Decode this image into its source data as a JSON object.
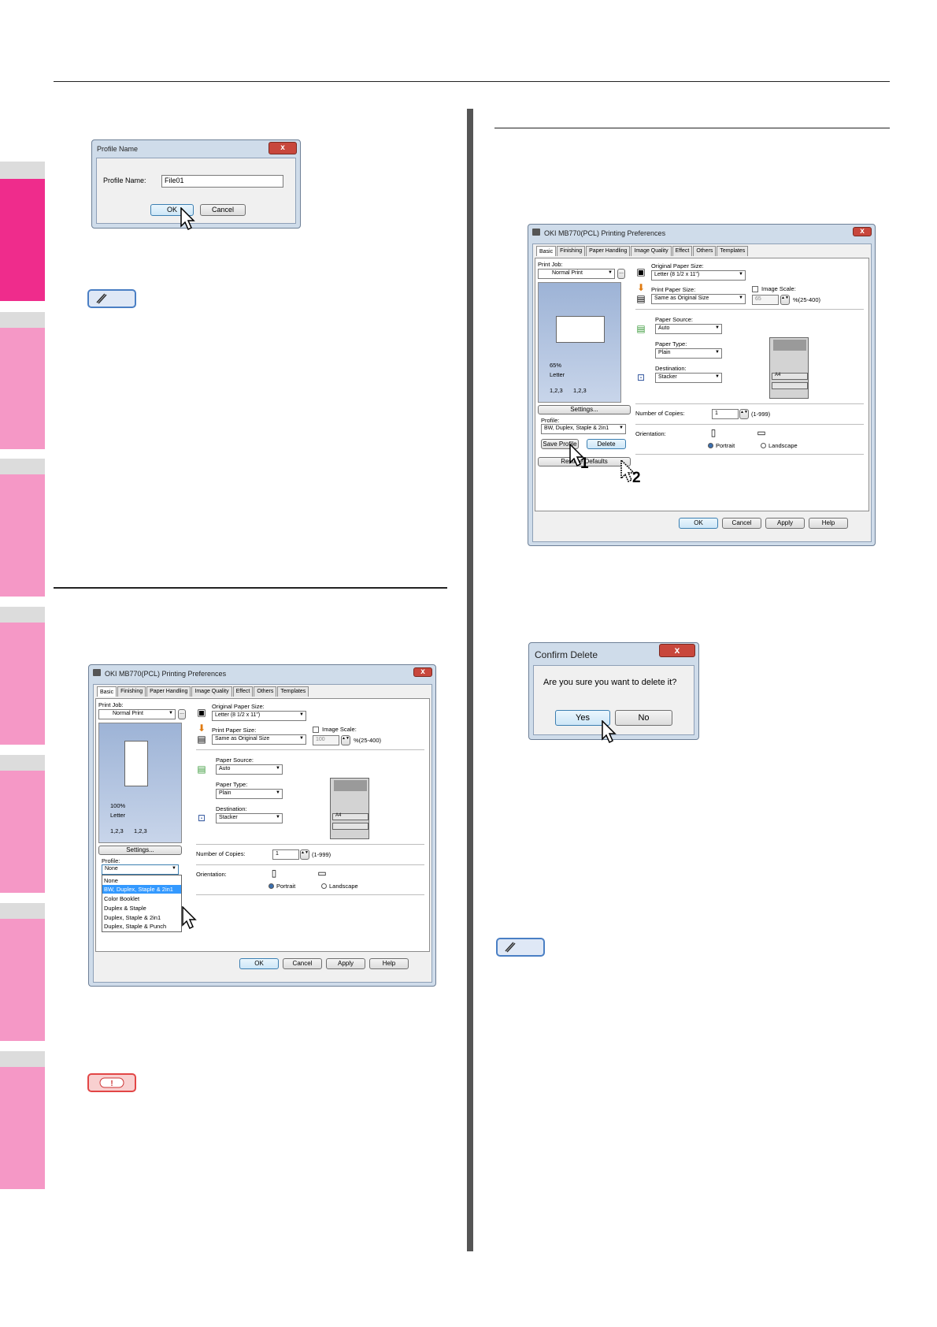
{
  "profile_name_dialog": {
    "title": "Profile Name",
    "close_glyph": "x",
    "field_label": "Profile Name:",
    "field_value": "File01",
    "ok": "OK",
    "cancel": "Cancel"
  },
  "prefs_dialog_1": {
    "title": "OKI MB770(PCL) Printing Preferences",
    "tabs": [
      "Basic",
      "Finishing",
      "Paper Handling",
      "Image Quality",
      "Effect",
      "Others",
      "Templates"
    ],
    "print_job_label": "Print Job:",
    "print_job_value": "Normal Print",
    "original_paper_size_label": "Original Paper Size:",
    "original_paper_size_value": "Letter (8 1/2 x 11\")",
    "print_paper_size_label": "Print Paper Size:",
    "print_paper_size_value": "Same as Original Size",
    "image_scale_label": "Image Scale:",
    "image_scale_value": "100",
    "image_scale_range": "%(25-400)",
    "paper_source_label": "Paper Source:",
    "paper_source_value": "Auto",
    "paper_type_label": "Paper Type:",
    "paper_type_value": "Plain",
    "destination_label": "Destination:",
    "destination_value": "Stacker",
    "zoom": "100%",
    "paper_name": "Letter",
    "collate_a": "1,2,3",
    "collate_b": "1,2,3",
    "settings_button": "Settings...",
    "profile_label": "Profile:",
    "profile_value": "None",
    "profile_options": [
      "None",
      "BW, Duplex, Staple & 2in1",
      "Color Booklet",
      "Duplex & Staple",
      "Duplex, Staple & 2in1",
      "Duplex, Staple & Punch"
    ],
    "copies_label": "Number of Copies:",
    "copies_value": "1",
    "copies_range": "(1-999)",
    "orientation_label": "Orientation:",
    "portrait": "Portrait",
    "landscape": "Landscape",
    "tray_label": "A4",
    "ok": "OK",
    "cancel": "Cancel",
    "apply": "Apply",
    "help": "Help"
  },
  "prefs_dialog_2": {
    "title": "OKI MB770(PCL) Printing Preferences",
    "tabs": [
      "Basic",
      "Finishing",
      "Paper Handling",
      "Image Quality",
      "Effect",
      "Others",
      "Templates"
    ],
    "print_job_label": "Print Job:",
    "print_job_value": "Normal Print",
    "original_paper_size_label": "Original Paper Size:",
    "original_paper_size_value": "Letter (8 1/2 x 11\")",
    "print_paper_size_label": "Print Paper Size:",
    "print_paper_size_value": "Same as Original Size",
    "image_scale_label": "Image Scale:",
    "image_scale_value": "65",
    "image_scale_range": "%(25-400)",
    "paper_source_label": "Paper Source:",
    "paper_source_value": "Auto",
    "paper_type_label": "Paper Type:",
    "paper_type_value": "Plain",
    "destination_label": "Destination:",
    "destination_value": "Stacker",
    "zoom": "65%",
    "paper_name": "Letter",
    "collate_a": "1,2,3",
    "collate_b": "1,2,3",
    "settings_button": "Settings...",
    "profile_label": "Profile:",
    "profile_value": "BW, Duplex, Staple & 2in1",
    "save_button": "Save Profile",
    "delete_button": "Delete",
    "restore_button": "Restore Defaults",
    "copies_label": "Number of Copies:",
    "copies_value": "1",
    "copies_range": "(1-999)",
    "orientation_label": "Orientation:",
    "portrait": "Portrait",
    "landscape": "Landscape",
    "tray_label": "A4",
    "step1": "1",
    "step2": "2",
    "ok": "OK",
    "cancel": "Cancel",
    "apply": "Apply",
    "help": "Help"
  },
  "confirm_dialog": {
    "title": "Confirm Delete",
    "close_glyph": "x",
    "message": "Are you sure you want to delete it?",
    "yes": "Yes",
    "no": "No"
  },
  "colors": {
    "side_tab_active": "#ef2c8c",
    "side_tab": "#f598c6",
    "memo_border": "#4a7fc4",
    "warn_border": "#e24646"
  }
}
